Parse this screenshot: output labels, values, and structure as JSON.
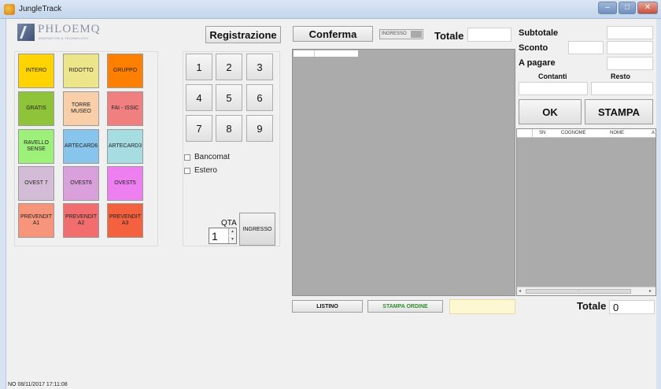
{
  "window": {
    "title": "JungleTrack",
    "min": "–",
    "max": "□",
    "close": "✕"
  },
  "logo": {
    "name": "PHLOEMQ",
    "tagline": "INNOVATION & TECHNOLOGY"
  },
  "tickets": [
    {
      "label": "INTERO",
      "color": "#ffd400"
    },
    {
      "label": "RIDOTTO",
      "color": "#ece58a"
    },
    {
      "label": "GRUPPO",
      "color": "#ff8000"
    },
    {
      "label": "GRATIS",
      "color": "#8fc33a"
    },
    {
      "label": "TORRE MUSEO",
      "color": "#f9cfa9"
    },
    {
      "label": "FAI - ISSIC",
      "color": "#f08080"
    },
    {
      "label": "RAVELLO SENSE",
      "color": "#9df07a"
    },
    {
      "label": "ARTECARD6",
      "color": "#87c5ec"
    },
    {
      "label": "ARTECARD3",
      "color": "#a6dde2"
    },
    {
      "label": "OVEST 7",
      "color": "#d3bcd6"
    },
    {
      "label": "OVEST6",
      "color": "#d9a0db"
    },
    {
      "label": "OVEST5",
      "color": "#ee7ff0"
    },
    {
      "label": "PREVENDIT A1",
      "color": "#f7957a"
    },
    {
      "label": "PREVENDIT A2",
      "color": "#f26e6e"
    },
    {
      "label": "PREVENDIT A3",
      "color": "#f4613e"
    }
  ],
  "keypad": [
    "1",
    "2",
    "3",
    "4",
    "5",
    "6",
    "7",
    "8",
    "9"
  ],
  "checkboxes": {
    "bancomat": "Bancomat",
    "estero": "Estero"
  },
  "qta": {
    "label": "QTA",
    "value": "1",
    "up": "▲",
    "down": "▼"
  },
  "buttons": {
    "registrazione": "Registrazione",
    "conferma": "Conferma",
    "ingresso_toggle": "INGRESSO",
    "ingresso": "INGRESSO",
    "listino": "LISTINO",
    "stampa_ordine": "STAMPA ORDINE",
    "ok": "OK",
    "stampa": "STAMPA"
  },
  "labels": {
    "totale": "Totale",
    "subtotale": "Subtotale",
    "sconto": "Sconto",
    "a_pagare": "A pagare",
    "contanti": "Contanti",
    "resto": "Resto",
    "totale_bottom": "Totale"
  },
  "totale_bottom_value": "0",
  "right_grid": {
    "columns": [
      "SN",
      "COGNOME",
      "NOME",
      "A"
    ],
    "scroll_left": "◂",
    "scroll_right": "▸",
    "scroll_grip": "⋯"
  },
  "status": "NO 08/11/2017 17:11:08"
}
